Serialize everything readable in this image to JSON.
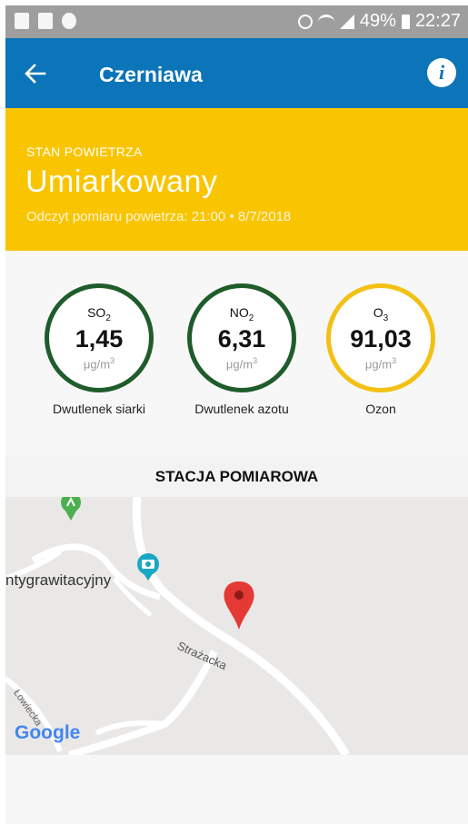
{
  "status_bar": {
    "battery": "49%",
    "time": "22:27"
  },
  "app_bar": {
    "title": "Czerniawa",
    "back_icon": "arrow-left-icon",
    "info_icon": "info-icon",
    "info_glyph": "i"
  },
  "air": {
    "label": "STAN POWIETRZA",
    "value": "Umiarkowany",
    "measured": "Odczyt pomiaru powietrza: 21:00 • 8/7/2018",
    "color": "#f9c400"
  },
  "readings": [
    {
      "formula": "SO",
      "sub": "2",
      "value": "1,45",
      "unit": "μg/m",
      "sup": "3",
      "name": "Dwutlenek siarki",
      "color": "#1f5c2b"
    },
    {
      "formula": "NO",
      "sub": "2",
      "value": "6,31",
      "unit": "μg/m",
      "sup": "3",
      "name": "Dwutlenek azotu",
      "color": "#1f5c2b"
    },
    {
      "formula": "O",
      "sub": "3",
      "value": "91,03",
      "unit": "μg/m",
      "sup": "3",
      "name": "Ozon",
      "color": "#f3c014"
    }
  ],
  "station": {
    "heading": "STACJA POMIAROWA",
    "map": {
      "poi_label": "ntygrawitacyjny",
      "street_1": "Strażacka",
      "street_2": "Łowiecka",
      "logo": "Google"
    }
  }
}
